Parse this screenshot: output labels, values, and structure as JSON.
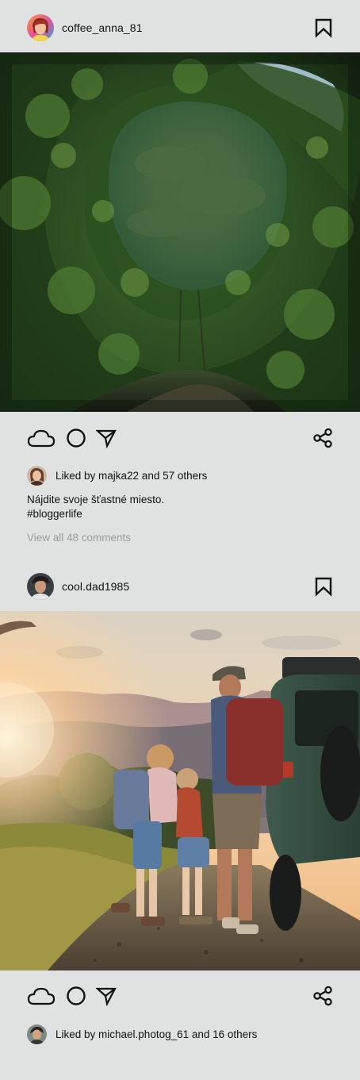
{
  "posts": [
    {
      "username": "coffee_anna_81",
      "image_alt": "Forest canopy fisheye view",
      "likes_text": "Liked by majka22 and 57 others",
      "caption_line1": "Nájdite svoje šťastné miesto.",
      "caption_line2": "#bloggerlife",
      "comments_link": "View all 48 comments"
    },
    {
      "username": "cool.dad1985",
      "image_alt": "Family hiking near car at sunset",
      "likes_text": "Liked by michael.photog_61 and 16 others"
    }
  ],
  "icons": {
    "like": "cloud-icon",
    "comment": "circle-icon",
    "send": "send-icon",
    "share": "share-icon",
    "save": "bookmark-icon"
  }
}
